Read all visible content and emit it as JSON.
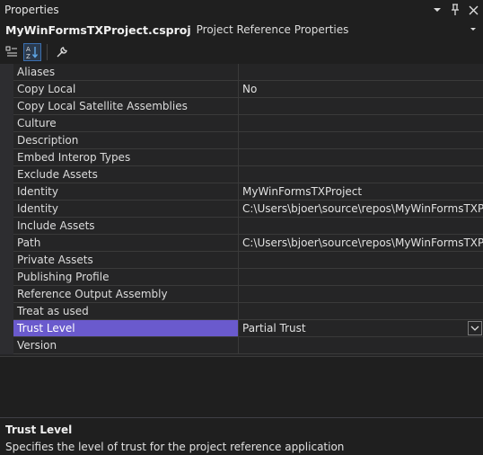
{
  "window": {
    "title": "Properties"
  },
  "object": {
    "name": "MyWinFormsTXProject.csproj",
    "type": "Project Reference Properties"
  },
  "properties": [
    {
      "name": "Aliases",
      "value": ""
    },
    {
      "name": "Copy Local",
      "value": "No"
    },
    {
      "name": "Copy Local Satellite Assemblies",
      "value": ""
    },
    {
      "name": "Culture",
      "value": ""
    },
    {
      "name": "Description",
      "value": ""
    },
    {
      "name": "Embed Interop Types",
      "value": ""
    },
    {
      "name": "Exclude Assets",
      "value": ""
    },
    {
      "name": "Identity",
      "value": "MyWinFormsTXProject"
    },
    {
      "name": "Identity",
      "value": "C:\\Users\\bjoer\\source\\repos\\MyWinFormsTXProject"
    },
    {
      "name": "Include Assets",
      "value": ""
    },
    {
      "name": "Path",
      "value": "C:\\Users\\bjoer\\source\\repos\\MyWinFormsTXProject"
    },
    {
      "name": "Private Assets",
      "value": ""
    },
    {
      "name": "Publishing Profile",
      "value": ""
    },
    {
      "name": "Reference Output Assembly",
      "value": ""
    },
    {
      "name": "Treat as used",
      "value": ""
    },
    {
      "name": "Trust Level",
      "value": "Partial Trust"
    },
    {
      "name": "Version",
      "value": ""
    }
  ],
  "selected_property": "Trust Level",
  "description": {
    "title": "Trust Level",
    "text": "Specifies the level of trust for the project reference application"
  },
  "colors": {
    "selection": "#6a5acd",
    "background": "#1f1f1f",
    "grid": "#252526"
  }
}
